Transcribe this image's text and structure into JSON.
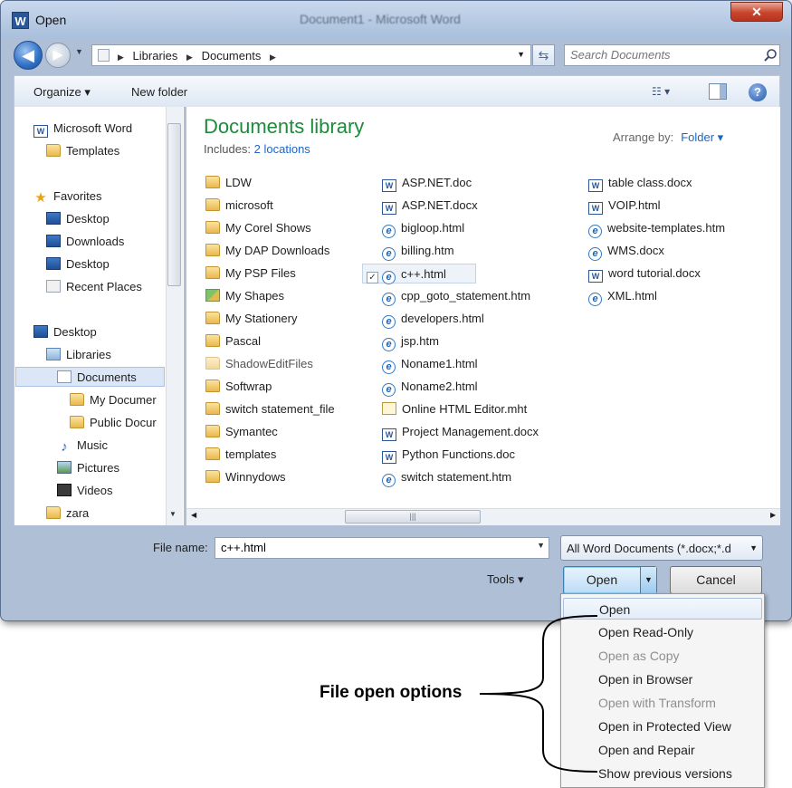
{
  "window": {
    "title": "Open",
    "center_title": "Document1 - Microsoft Word",
    "app_icon": "W"
  },
  "address": {
    "crumbs": [
      "Libraries",
      "Documents"
    ],
    "search_placeholder": "Search Documents"
  },
  "toolbar": {
    "organize": "Organize ▾",
    "new_folder": "New folder",
    "view": "☷ ▾",
    "help": "?"
  },
  "nav": {
    "items": [
      {
        "label": "Microsoft Word",
        "icon": "word-icon"
      },
      {
        "label": "Templates",
        "icon": "folder-icon"
      },
      {
        "label": "Favorites",
        "icon": "star-icon"
      },
      {
        "label": "Desktop",
        "icon": "monitor-icon"
      },
      {
        "label": "Downloads",
        "icon": "monitor-icon"
      },
      {
        "label": "Desktop",
        "icon": "monitor-icon"
      },
      {
        "label": "Recent Places",
        "icon": "recent-places-icon"
      },
      {
        "label": "Desktop",
        "icon": "monitor-icon"
      },
      {
        "label": "Libraries",
        "icon": "library-icon"
      },
      {
        "label": "Documents",
        "icon": "document-library-icon"
      },
      {
        "label": "My Documer",
        "icon": "folder-icon"
      },
      {
        "label": "Public Docur",
        "icon": "folder-icon"
      },
      {
        "label": "Music",
        "icon": "music-icon"
      },
      {
        "label": "Pictures",
        "icon": "pictures-icon"
      },
      {
        "label": "Videos",
        "icon": "videos-icon"
      },
      {
        "label": "zara",
        "icon": "folder-icon"
      }
    ]
  },
  "library": {
    "title": "Documents library",
    "includes_prefix": "Includes: ",
    "includes_link": "2 locations",
    "arrange_label": "Arrange by:",
    "arrange_value": "Folder ▾"
  },
  "files": {
    "col1": [
      "LDW",
      "microsoft",
      "My Corel Shows",
      "My DAP Downloads",
      "My PSP Files",
      "My Shapes",
      "My Stationery",
      "Pascal",
      "ShadowEditFiles",
      "Softwrap",
      "switch statement_file",
      "Symantec",
      "templates",
      "Winnydows"
    ],
    "col2": [
      "ASP.NET.doc",
      "ASP.NET.docx",
      "bigloop.html",
      "billing.htm",
      "c++.html",
      "cpp_goto_statement.htm",
      "developers.html",
      "jsp.htm",
      "Noname1.html",
      "Noname2.html",
      "Online HTML Editor.mht",
      "Project Management.docx",
      "Python Functions.doc",
      "switch statement.htm"
    ],
    "col3": [
      "table class.docx",
      "VOIP.html",
      "website-templates.htm",
      "WMS.docx",
      "word tutorial.docx",
      "XML.html"
    ]
  },
  "bottom": {
    "filename_label": "File name:",
    "filename_value": "c++.html",
    "filter_value": "All Word Documents (*.docx;*.d",
    "tools": "Tools ▾",
    "open": "Open",
    "cancel": "Cancel"
  },
  "open_menu": [
    {
      "label": "Open",
      "enabled": true
    },
    {
      "label": "Open Read-Only",
      "enabled": true
    },
    {
      "label": "Open as Copy",
      "enabled": false
    },
    {
      "label": "Open in Browser",
      "enabled": true
    },
    {
      "label": "Open with Transform",
      "enabled": false
    },
    {
      "label": "Open in Protected View",
      "enabled": true
    },
    {
      "label": "Open and Repair",
      "enabled": true
    },
    {
      "label": "Show previous versions",
      "enabled": true
    }
  ],
  "annotation": "File open options"
}
